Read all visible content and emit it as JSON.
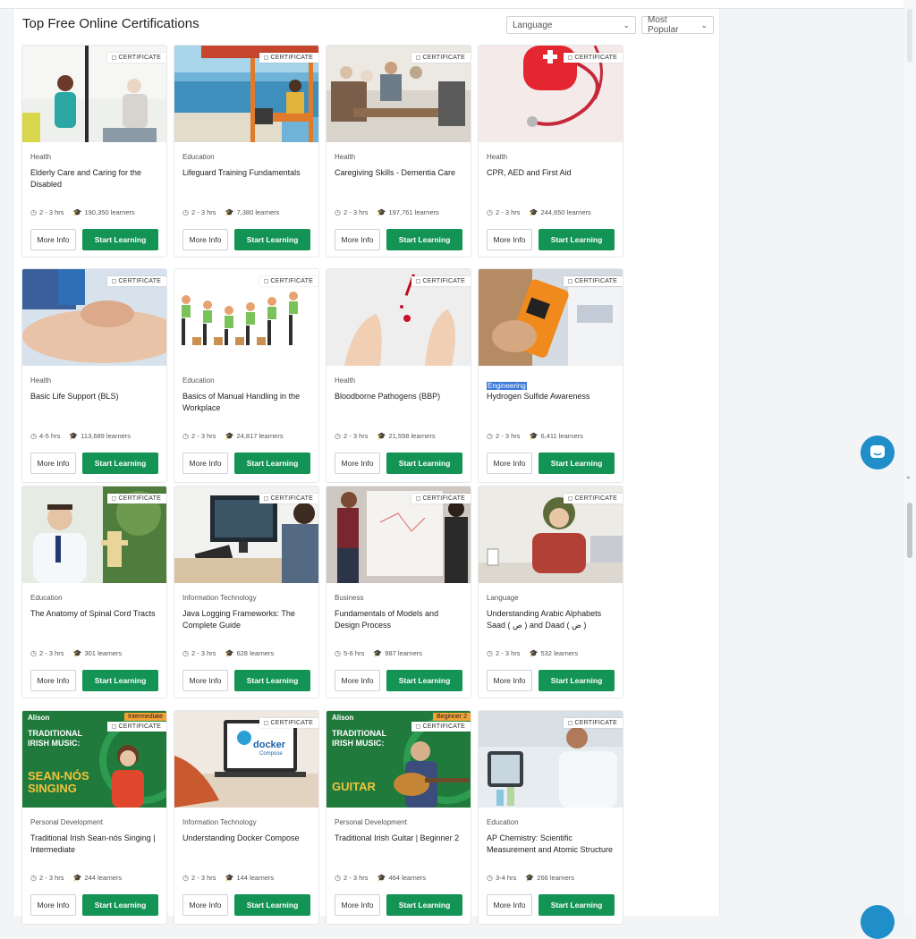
{
  "page": {
    "title": "Top Free Online Certifications",
    "language_select": "Language",
    "sort_select": "Most Popular"
  },
  "common": {
    "badge": "CERTIFICATE",
    "more_info": "More Info",
    "start_learning": "Start Learning"
  },
  "courses": [
    {
      "category": "Health",
      "title": "Elderly Care and Caring for the Disabled",
      "duration": "2 - 3 hrs",
      "learners": "190,350 learners"
    },
    {
      "category": "Education",
      "title": "Lifeguard Training Fundamentals",
      "duration": "2 - 3 hrs",
      "learners": "7,380 learners"
    },
    {
      "category": "Health",
      "title": "Caregiving Skills - Dementia Care",
      "duration": "2 - 3 hrs",
      "learners": "197,761 learners"
    },
    {
      "category": "Health",
      "title": "CPR, AED and First Aid",
      "duration": "2 - 3 hrs",
      "learners": "244,650 learners"
    },
    {
      "category": "Health",
      "title": "Basic Life Support (BLS)",
      "duration": "4-5 hrs",
      "learners": "113,689 learners"
    },
    {
      "category": "Education",
      "title": "Basics of Manual Handling in the Workplace",
      "duration": "2 - 3 hrs",
      "learners": "24,817 learners"
    },
    {
      "category": "Health",
      "title": "Bloodborne Pathogens (BBP)",
      "duration": "2 - 3 hrs",
      "learners": "21,558 learners"
    },
    {
      "category": "Engineering",
      "title": "Hydrogen Sulfide Awareness",
      "duration": "2 - 3 hrs",
      "learners": "6,411 learners"
    },
    {
      "category": "Education",
      "title": "The Anatomy of Spinal Cord Tracts",
      "duration": "2 - 3 hrs",
      "learners": "301 learners"
    },
    {
      "category": "Information Technology",
      "title": "Java Logging Frameworks: The Complete Guide",
      "duration": "2 - 3 hrs",
      "learners": "628 learners"
    },
    {
      "category": "Business",
      "title": "Fundamentals of Models and Design Process",
      "duration": "5-6 hrs",
      "learners": "987 learners"
    },
    {
      "category": "Language",
      "title": "Understanding Arabic Alphabets Saad ( ص ) and Daad ( ض )",
      "duration": "2 - 3 hrs",
      "learners": "532 learners"
    },
    {
      "category": "Personal Development",
      "title": "Traditional Irish Sean-nós Singing | Intermediate",
      "duration": "2 - 3 hrs",
      "learners": "244 learners"
    },
    {
      "category": "Information Technology",
      "title": "Understanding Docker Compose",
      "duration": "2 - 3 hrs",
      "learners": "144 learners"
    },
    {
      "category": "Personal Development",
      "title": "Traditional Irish Guitar | Beginner 2",
      "duration": "2 - 3 hrs",
      "learners": "464 learners"
    },
    {
      "category": "Education",
      "title": "AP Chemistry: Scientific Measurement and Atomic Structure",
      "duration": "3-4 hrs",
      "learners": "266 learners"
    }
  ],
  "banners": {
    "logo": "Alison",
    "singing": {
      "level": "Intermediate",
      "line1": "TRADITIONAL",
      "line2": "IRISH MUSIC:",
      "big1": "SEAN-NÓS",
      "big2": "SINGING"
    },
    "guitar": {
      "level": "Beginner 2",
      "line1": "TRADITIONAL",
      "line2": "IRISH MUSIC:",
      "big1": "GUITAR"
    },
    "docker": {
      "word": "docker",
      "sub": "Compose"
    }
  },
  "colors": {
    "accent": "#139455",
    "chat": "#1f8ec9",
    "highlight": "#3b7ad8"
  }
}
